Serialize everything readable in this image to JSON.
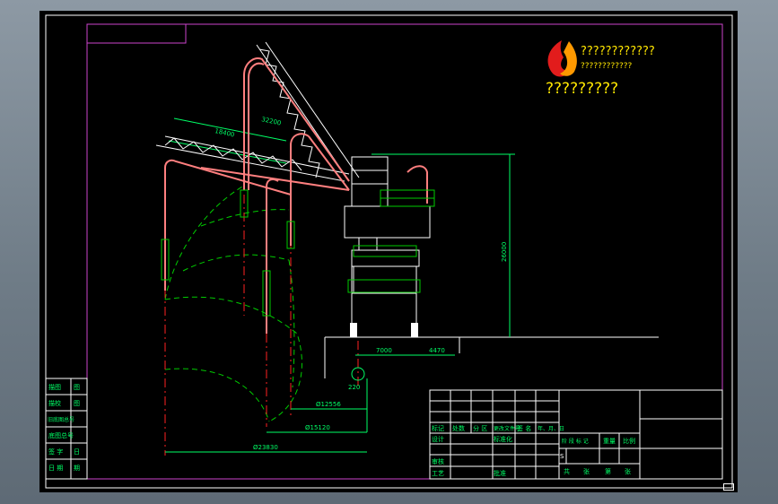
{
  "title": {
    "line1": "????????????",
    "line1_under": "????????????",
    "line2": "?????????"
  },
  "colors": {
    "frame": "#cc44cc",
    "border": "#ffffff",
    "table": "#ffffff",
    "crane": "#ff7f7f",
    "truss": "#ffffff",
    "dim": "#00ff66",
    "arc": "#00cc00",
    "center": "#ff2222",
    "text_green": "#00ff66",
    "title_yellow": "#ffe600",
    "logo_red": "#e21c1c",
    "logo_orange": "#ff9900"
  },
  "dimensions": {
    "boom_upper": "32200",
    "boom_lower": "18400",
    "height": "26000",
    "base_left": "7000",
    "base_right": "4470",
    "small_radius": "220",
    "r1": "Ø12556",
    "r2": "Ø15120",
    "r3": "Ø23830"
  },
  "side_table": {
    "rows": [
      [
        "描图",
        "图"
      ],
      [
        "描校",
        "图"
      ],
      [
        "旧底图总号",
        ""
      ],
      [
        "底图总号",
        ""
      ],
      [
        "签 字",
        "日"
      ],
      [
        "日 期",
        "期"
      ]
    ]
  },
  "title_block": {
    "row1": [
      "标记",
      "处数",
      "分 区",
      "更改文件号",
      "签 名",
      "年、月、日"
    ],
    "row2": [
      "设计",
      "标准化"
    ],
    "row3": [
      "审核"
    ],
    "row4": [
      "工艺",
      "批准"
    ],
    "stage_labels": [
      "阶 段 标 记",
      "重量",
      "比例"
    ],
    "stage_value": "S",
    "sheet_labels": [
      "共",
      "张",
      "第",
      "张"
    ]
  }
}
